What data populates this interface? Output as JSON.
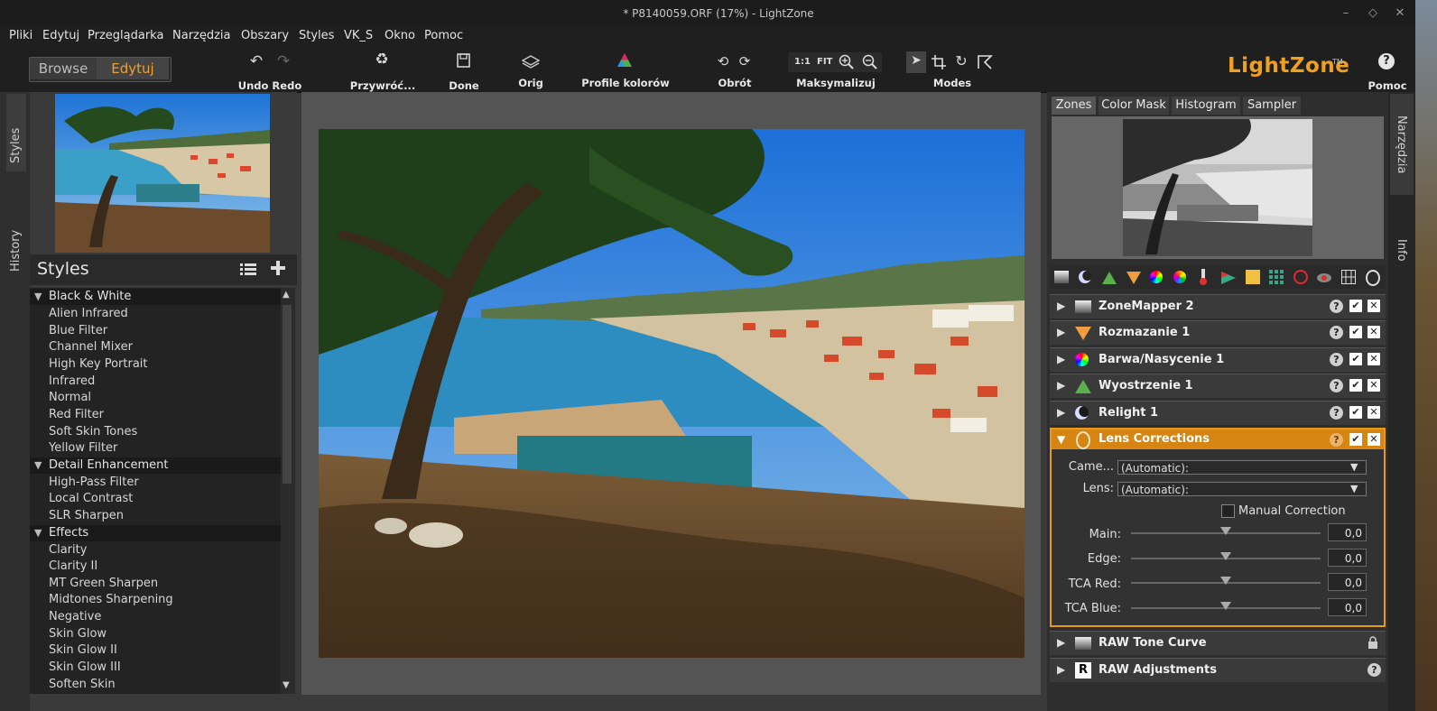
{
  "window": {
    "title": "* P8140059.ORF (17%) - LightZone",
    "min": "–",
    "max": "◇",
    "close": "✕"
  },
  "menu": [
    "Pliki",
    "Edytuj",
    "Przeglądarka",
    "Narzędzia",
    "Obszary",
    "Styles",
    "VK_S",
    "Okno",
    "Pomoc"
  ],
  "mode": {
    "browse": "Browse",
    "edit": "Edytuj"
  },
  "toolbar": {
    "undo_redo": "Undo Redo",
    "revert": "Przywróć...",
    "done": "Done",
    "orig": "Orig",
    "color_profiles": "Profile kolorów",
    "rotate": "Obrót",
    "zoom_1to1": "1:1",
    "zoom_fit": "FIT",
    "maximize": "Maksymalizuj",
    "modes": "Modes",
    "help": "Pomoc"
  },
  "logo": {
    "text": "LightZone",
    "tm": "TM"
  },
  "left_tabs": {
    "styles": "Styles",
    "history": "History"
  },
  "styles_panel": {
    "title": "Styles",
    "categories": [
      {
        "name": "Black & White",
        "items": [
          "Alien Infrared",
          "Blue Filter",
          "Channel Mixer",
          "High Key Portrait",
          "Infrared",
          "Normal",
          "Red Filter",
          "Soft Skin Tones",
          "Yellow Filter"
        ]
      },
      {
        "name": "Detail Enhancement",
        "items": [
          "High-Pass Filter",
          "Local Contrast",
          "SLR Sharpen"
        ]
      },
      {
        "name": "Effects",
        "items": [
          "Clarity",
          "Clarity II",
          "MT Green Sharpen",
          "Midtones Sharpening",
          "Negative",
          "Skin Glow",
          "Skin Glow II",
          "Skin Glow III",
          "Soften Skin"
        ]
      }
    ]
  },
  "right_tabs": {
    "tools": "Narzędzia",
    "info": "Info"
  },
  "zone_tabs": [
    "Zones",
    "Color Mask",
    "Histogram",
    "Sampler"
  ],
  "tools": [
    {
      "name": "ZoneMapper 2",
      "icon": "zonemapper-icon"
    },
    {
      "name": "Rozmazanie 1",
      "icon": "blur-icon"
    },
    {
      "name": "Barwa/Nasycenie 1",
      "icon": "hue-saturation-icon"
    },
    {
      "name": "Wyostrzenie 1",
      "icon": "sharpen-icon"
    },
    {
      "name": "Relight 1",
      "icon": "relight-icon"
    }
  ],
  "lens": {
    "title": "Lens Corrections",
    "camera_label": "Came...",
    "camera_value": "(Automatic):",
    "lens_label": "Lens:",
    "lens_value": "(Automatic):",
    "manual": "Manual Correction",
    "sliders": [
      {
        "label": "Main:",
        "value": "0,0",
        "level": 0.5
      },
      {
        "label": "Edge:",
        "value": "0,0",
        "level": 0.5
      },
      {
        "label": "TCA Red:",
        "value": "0,0",
        "level": 0.5
      },
      {
        "label": "TCA Blue:",
        "value": "0,0",
        "level": 0.5
      }
    ]
  },
  "bottom_tools": [
    {
      "name": "RAW Tone Curve",
      "icon": "tone-curve-icon"
    },
    {
      "name": "RAW Adjustments",
      "icon": "raw-adjustments-icon"
    }
  ],
  "colors": {
    "accent": "#f0a020",
    "lens_header": "#d68512"
  }
}
